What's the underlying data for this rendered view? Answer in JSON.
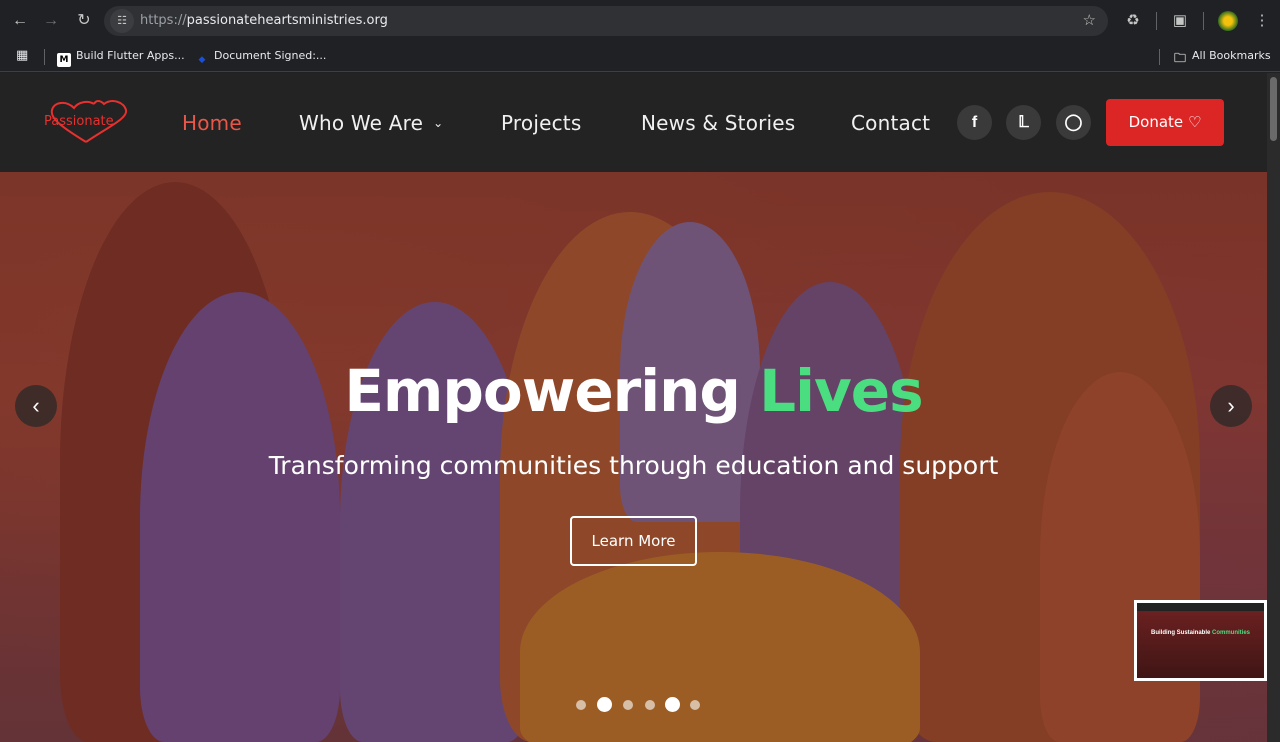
{
  "browser": {
    "url_scheme": "https://",
    "url_host": "passionateheartsministries.org",
    "bookmarks": [
      {
        "label": "Build Flutter Apps..."
      },
      {
        "label": "Document Signed:..."
      }
    ],
    "all_bookmarks_label": "All Bookmarks"
  },
  "site": {
    "logo_text": "Passionate",
    "nav": [
      {
        "label": "Home",
        "active": true
      },
      {
        "label": "Who We Are"
      },
      {
        "label": "Projects"
      },
      {
        "label": "News & Stories"
      },
      {
        "label": "Contact"
      }
    ],
    "social": [
      "facebook-icon",
      "twitter-icon",
      "instagram-icon"
    ],
    "donate_label": "Donate",
    "colors": {
      "brand_red": "#dc2626",
      "accent_green": "#4ade80",
      "header_bg": "#232323"
    }
  },
  "hero": {
    "title_main": "Empowering",
    "title_accent": "Lives",
    "subtitle": "Transforming communities through education and support",
    "cta_label": "Learn More",
    "slide_count": 6,
    "active_slide": 5
  },
  "thumbnail": {
    "title_main": "Building Sustainable",
    "title_accent": "Communities"
  }
}
